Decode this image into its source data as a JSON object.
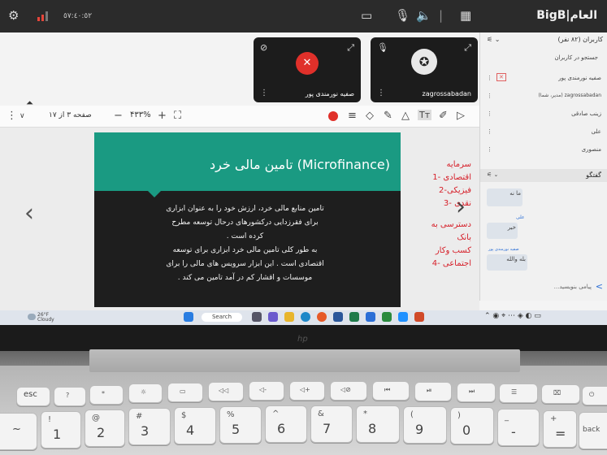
{
  "screen": {
    "brand": "BigB|العام",
    "time_status": "٥٧:٤٠:٥٢"
  },
  "videos": [
    {
      "name": "صفیه نورمندی پور",
      "muted": true
    },
    {
      "name": "zagrossabadan",
      "muted": false
    }
  ],
  "whiteboard": {
    "page_label": "صفحه ۳ از ۱۷",
    "zoom": "۴۳۳%"
  },
  "slide": {
    "title": "تامین مالی خرد (Microfinance)",
    "body": [
      "تامین منابع مالی خرد، ارزش خود را به عنوان ابزاری",
      "برای فقرزدایی درکشورهای درحال توسعه مطرح",
      "کرده است .",
      "به طور کلی تامین مالی خرد ابزاری برای توسعه",
      "اقتصادی است . این ابزار سرویس های مالی را برای",
      "موسسات و اقشار کم در آمد تامین می کند ."
    ]
  },
  "annotation": [
    "سرمایه",
    "اقتصادی -1",
    "فیزیکی-2",
    "نقدی -3",
    "",
    "دسترسی به بانک",
    "کسب وکار",
    "اجتماعی -4"
  ],
  "panel": {
    "users_header": "کاربران (۸۲ نفر)",
    "search": "جستجو در کاربران",
    "users": [
      "صفیه نورمندی پور",
      "zagrossabadan (مدیر، شما)",
      "زینب صادقی",
      "علی",
      "منصوری"
    ],
    "chat_header": "گفتگو",
    "messages": [
      {
        "sender": "",
        "text": "ما نه"
      },
      {
        "sender": "علی",
        "text": "خیر"
      },
      {
        "sender": "صفیه نورمندی پور",
        "text": "بله والله"
      }
    ],
    "chat_placeholder": "پیامی بنویسید..."
  },
  "taskbar": {
    "weather_temp": "26°F",
    "weather_desc": "Cloudy",
    "search": "Search"
  },
  "keyboard": {
    "fn_row": [
      "esc",
      "?",
      "*",
      "☼",
      "▭",
      "◁◁",
      "◁-",
      "◁+",
      "◁⊘",
      "⏮",
      "⏯",
      "⏭",
      "☰",
      "⌧",
      "⏻"
    ],
    "num_row": [
      "~",
      "1",
      "2",
      "3",
      "4",
      "5",
      "6",
      "7",
      "8",
      "9",
      "0",
      "-",
      "=",
      "back"
    ],
    "num_shift": [
      "",
      "!",
      "@",
      "#",
      "$",
      "%",
      "^",
      "&",
      "*",
      "(",
      ")",
      "_",
      "+",
      ""
    ],
    "hp_logo": "hp"
  },
  "colors": {
    "slide_header": "#1a9a82",
    "annotation": "#d6202a",
    "record": "#e0302a"
  }
}
